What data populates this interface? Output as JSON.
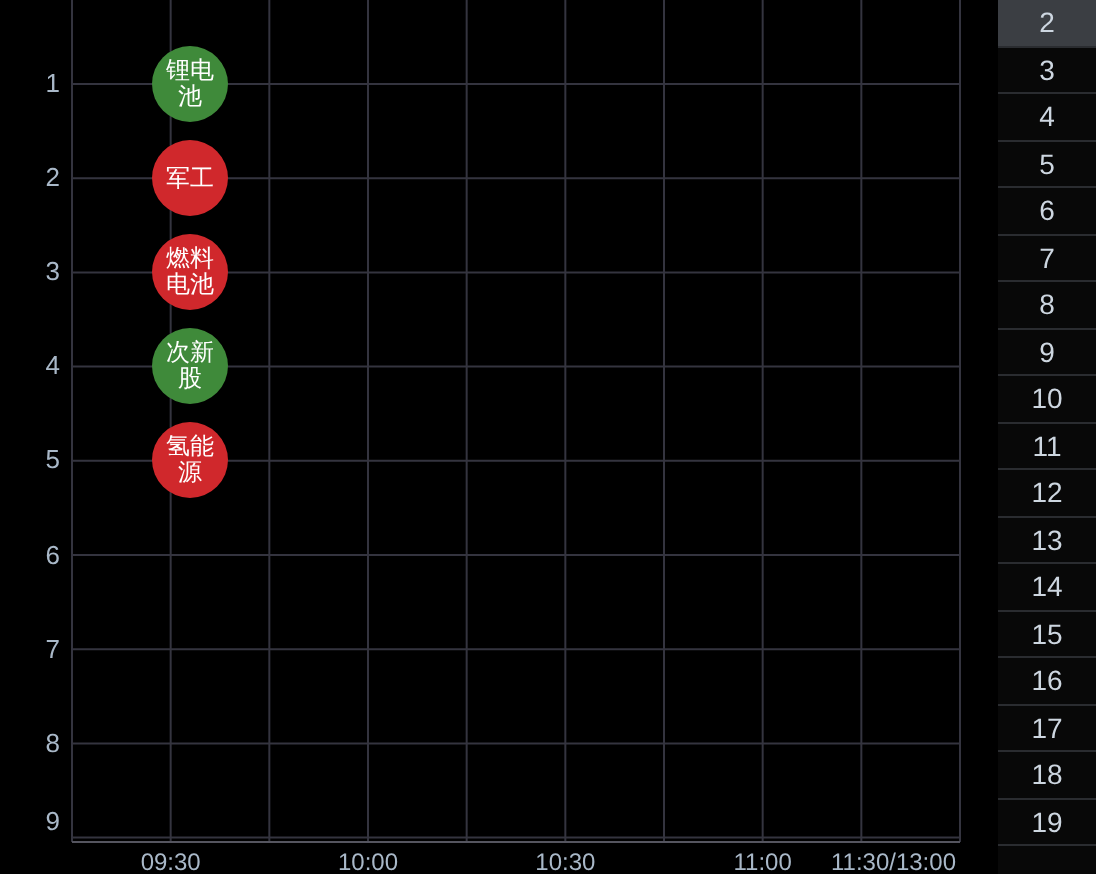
{
  "chart": {
    "y_labels": [
      "1",
      "2",
      "3",
      "4",
      "5",
      "6",
      "7",
      "8",
      "9"
    ],
    "x_labels": [
      "09:30",
      "10:00",
      "10:30",
      "11:00",
      "11:30/13:00"
    ],
    "bubbles": [
      {
        "label": "锂电池",
        "color": "#3f8a3a"
      },
      {
        "label": "军工",
        "color": "#d0282c"
      },
      {
        "label": "燃料电池",
        "color": "#d0282c"
      },
      {
        "label": "次新股",
        "color": "#3f8a3a"
      },
      {
        "label": "氢能源",
        "color": "#d0282c"
      }
    ]
  },
  "rank_list": [
    {
      "label": "2",
      "selected": true
    },
    {
      "label": "3",
      "selected": false
    },
    {
      "label": "4",
      "selected": false
    },
    {
      "label": "5",
      "selected": false
    },
    {
      "label": "6",
      "selected": false
    },
    {
      "label": "7",
      "selected": false
    },
    {
      "label": "8",
      "selected": false
    },
    {
      "label": "9",
      "selected": false
    },
    {
      "label": "10",
      "selected": false
    },
    {
      "label": "11",
      "selected": false
    },
    {
      "label": "12",
      "selected": false
    },
    {
      "label": "13",
      "selected": false
    },
    {
      "label": "14",
      "selected": false
    },
    {
      "label": "15",
      "selected": false
    },
    {
      "label": "16",
      "selected": false
    },
    {
      "label": "17",
      "selected": false
    },
    {
      "label": "18",
      "selected": false
    },
    {
      "label": "19",
      "selected": false
    }
  ]
}
